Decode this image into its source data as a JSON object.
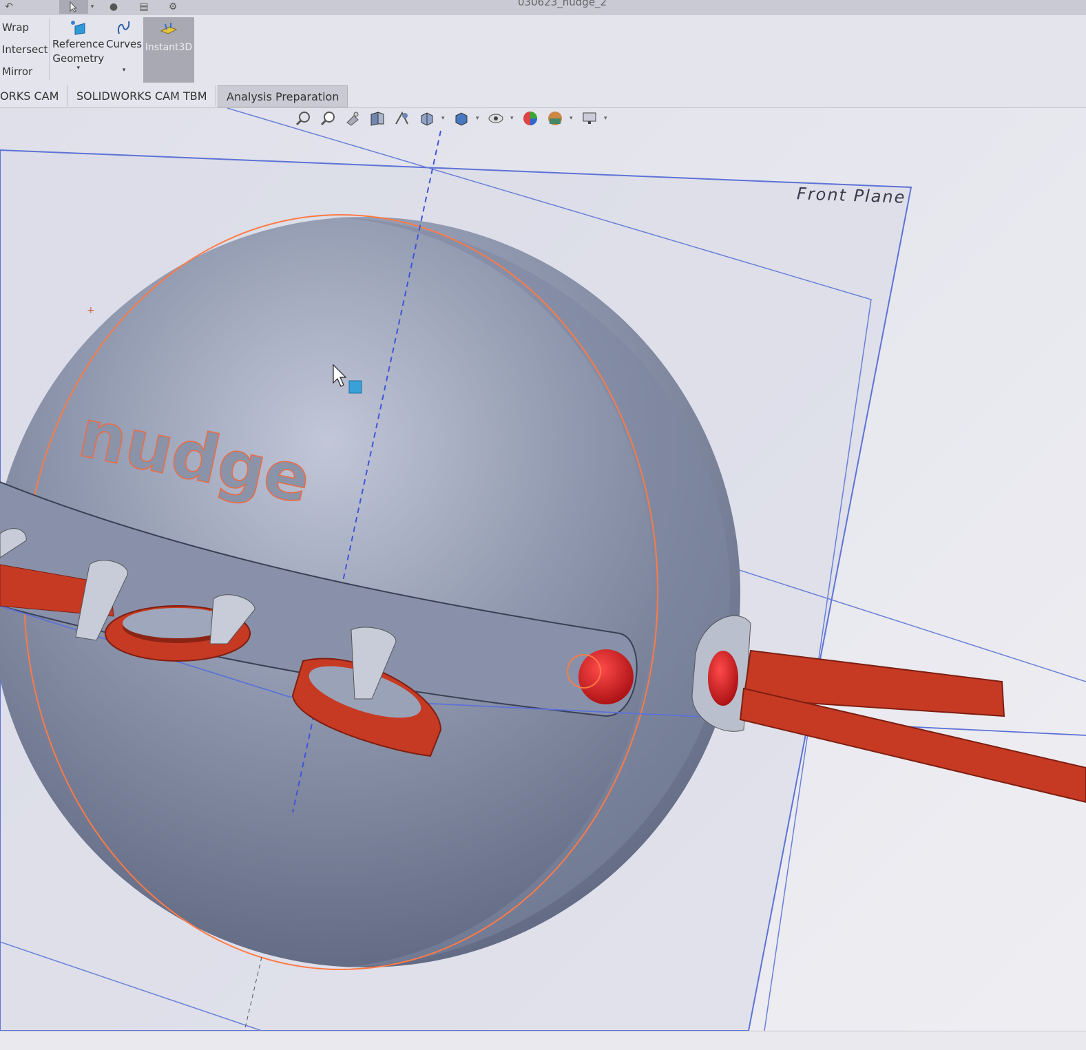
{
  "window": {
    "title": "030623_nudge_2"
  },
  "ribbon": {
    "features_small": [
      "Wrap",
      "Intersect",
      "Mirror"
    ],
    "reference_geometry": {
      "line1": "Reference",
      "line2": "Geometry"
    },
    "curves": "Curves",
    "instant3d": "Instant3D"
  },
  "tabs": [
    "ORKS CAM",
    "SOLIDWORKS CAM TBM",
    "Analysis Preparation"
  ],
  "viewport": {
    "plane_label": "Front Plane",
    "embossed_text": "nudge"
  },
  "colors": {
    "sphere": "#8d96ad",
    "red_parts": "#c63a24",
    "selection": "#ff7a45",
    "plane_edge": "#5d72d6"
  }
}
